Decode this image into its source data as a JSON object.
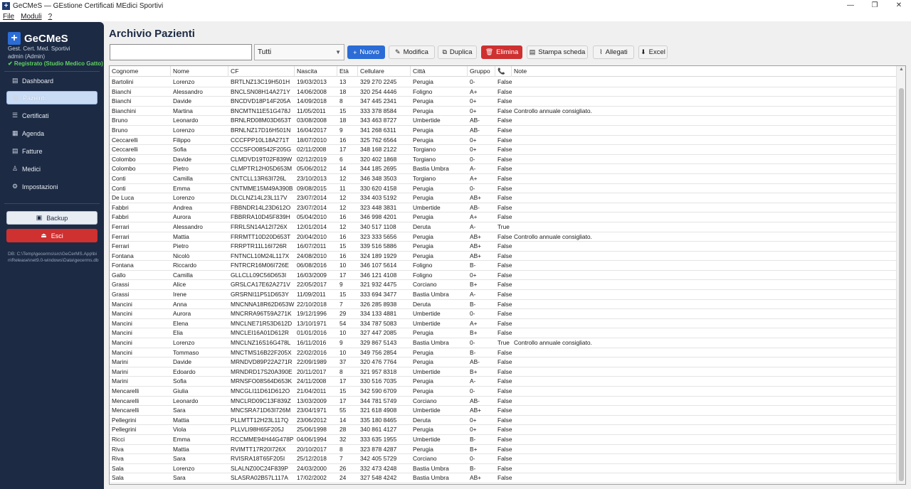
{
  "window": {
    "title": "GeCMeS — GEstione Certificati MEdici Sportivi"
  },
  "menu": [
    "File",
    "Moduli",
    "?"
  ],
  "sidebar": {
    "brand": "GeCMeS",
    "subtitle": "Gest. Cert. Med. Sportivi",
    "user": "admin (Admin)",
    "registered": "✔ Registrato (Studio Medico Gatto)",
    "items": [
      {
        "label": "Dashboard",
        "icon": "dashboard-icon",
        "glyph": "▤"
      },
      {
        "label": "Pazienti",
        "icon": "patients-icon",
        "glyph": "▦"
      },
      {
        "label": "Certificati",
        "icon": "certificate-icon",
        "glyph": "☰"
      },
      {
        "label": "Agenda",
        "icon": "calendar-icon",
        "glyph": "▦"
      },
      {
        "label": "Fatture",
        "icon": "invoice-icon",
        "glyph": "▤"
      },
      {
        "label": "Medici",
        "icon": "doctor-icon",
        "glyph": "♙"
      },
      {
        "label": "Impostazioni",
        "icon": "gear-icon",
        "glyph": "⚙"
      }
    ],
    "backup_label": "Backup",
    "exit_label": "Esci",
    "db_path": "DB: C:\\Temp\\gecerms\\src\\GeCerMS.App\\bin\\Release\\net9.0-windows\\Data\\gecerms.db"
  },
  "main": {
    "title": "Archivio Pazienti",
    "search": {
      "value": "",
      "placeholder": ""
    },
    "filter": "Tutti",
    "toolbar": {
      "new": "Nuovo",
      "edit": "Modifica",
      "duplicate": "Duplica",
      "delete": "Elimina",
      "print": "Stampa scheda",
      "attachments": "Allegati",
      "excel": "Excel"
    }
  },
  "table": {
    "columns": [
      "Cognome",
      "Nome",
      "CF",
      "Nascita",
      "Età",
      "Cellulare",
      "Città",
      "Gruppo",
      "📞",
      "Note"
    ],
    "rows": [
      [
        "Bartolini",
        "Lorenzo",
        "BRTLNZ13C19H501H",
        "19/03/2013",
        "13",
        "329 270 2245",
        "Perugia",
        "0-",
        "False",
        ""
      ],
      [
        "Bianchi",
        "Alessandro",
        "BNCLSN08H14A271Y",
        "14/06/2008",
        "18",
        "320 254 4446",
        "Foligno",
        "A+",
        "False",
        ""
      ],
      [
        "Bianchi",
        "Davide",
        "BNCDVD18P14F205A",
        "14/09/2018",
        "8",
        "347 445 2341",
        "Perugia",
        "0+",
        "False",
        ""
      ],
      [
        "Bianchini",
        "Martina",
        "BNCMTN11E51G478J",
        "11/05/2011",
        "15",
        "333 378 8584",
        "Perugia",
        "0+",
        "False",
        "Controllo annuale consigliato."
      ],
      [
        "Bruno",
        "Leonardo",
        "BRNLRD08M03D653T",
        "03/08/2008",
        "18",
        "343 463 8727",
        "Umbertide",
        "AB-",
        "False",
        ""
      ],
      [
        "Bruno",
        "Lorenzo",
        "BRNLNZ17D16H501N",
        "16/04/2017",
        "9",
        "341 268 6311",
        "Perugia",
        "AB-",
        "False",
        ""
      ],
      [
        "Ceccarelli",
        "Filippo",
        "CCCFPP10L18A271T",
        "18/07/2010",
        "16",
        "325 762 6564",
        "Perugia",
        "0+",
        "False",
        ""
      ],
      [
        "Ceccarelli",
        "Sofia",
        "CCCSFO08S42F205G",
        "02/11/2008",
        "17",
        "348 168 2122",
        "Torgiano",
        "0+",
        "False",
        ""
      ],
      [
        "Colombo",
        "Davide",
        "CLMDVD19T02F839W",
        "02/12/2019",
        "6",
        "320 402 1868",
        "Torgiano",
        "0-",
        "False",
        ""
      ],
      [
        "Colombo",
        "Pietro",
        "CLMPTR12H05D653M",
        "05/06/2012",
        "14",
        "344 185 2695",
        "Bastia Umbra",
        "A-",
        "False",
        ""
      ],
      [
        "Conti",
        "Camilla",
        "CNTCLL13R63I726L",
        "23/10/2013",
        "12",
        "346 348 3503",
        "Torgiano",
        "A+",
        "False",
        ""
      ],
      [
        "Conti",
        "Emma",
        "CNTMME15M49A390B",
        "09/08/2015",
        "11",
        "330 620 4158",
        "Perugia",
        "0-",
        "False",
        ""
      ],
      [
        "De Luca",
        "Lorenzo",
        "DLCLNZ14L23L117V",
        "23/07/2014",
        "12",
        "334 403 5192",
        "Perugia",
        "AB+",
        "False",
        ""
      ],
      [
        "Fabbri",
        "Andrea",
        "FBBNDR14L23D612O",
        "23/07/2014",
        "12",
        "323 448 3831",
        "Umbertide",
        "AB-",
        "False",
        ""
      ],
      [
        "Fabbri",
        "Aurora",
        "FBBRRA10D45F839H",
        "05/04/2010",
        "16",
        "346 998 4201",
        "Perugia",
        "A+",
        "False",
        ""
      ],
      [
        "Ferrari",
        "Alessandro",
        "FRRLSN14A12I726X",
        "12/01/2014",
        "12",
        "340 517 1108",
        "Deruta",
        "A-",
        "True",
        ""
      ],
      [
        "Ferrari",
        "Mattia",
        "FRRMTT10D20D653T",
        "20/04/2010",
        "16",
        "323 333 5656",
        "Perugia",
        "AB+",
        "False",
        "Controllo annuale consigliato."
      ],
      [
        "Ferrari",
        "Pietro",
        "FRRPTR11L16I726R",
        "16/07/2011",
        "15",
        "339 516 5886",
        "Perugia",
        "AB+",
        "False",
        ""
      ],
      [
        "Fontana",
        "Nicolò",
        "FNTNCL10M24L117X",
        "24/08/2010",
        "16",
        "324 189 1929",
        "Perugia",
        "AB+",
        "False",
        ""
      ],
      [
        "Fontana",
        "Riccardo",
        "FNTRCR16M06I726E",
        "06/08/2016",
        "10",
        "346 107 5614",
        "Foligno",
        "B-",
        "False",
        ""
      ],
      [
        "Gallo",
        "Camilla",
        "GLLCLL09C56D653I",
        "16/03/2009",
        "17",
        "346 121 4108",
        "Foligno",
        "0+",
        "False",
        ""
      ],
      [
        "Grassi",
        "Alice",
        "GRSLCA17E62A271V",
        "22/05/2017",
        "9",
        "321 932 4475",
        "Corciano",
        "B+",
        "False",
        ""
      ],
      [
        "Grassi",
        "Irene",
        "GRSRNI11P51D653Y",
        "11/09/2011",
        "15",
        "333 694 3477",
        "Bastia Umbra",
        "A-",
        "False",
        ""
      ],
      [
        "Mancini",
        "Anna",
        "MNCNNA18R62D653W",
        "22/10/2018",
        "7",
        "326 285 8938",
        "Deruta",
        "B-",
        "False",
        ""
      ],
      [
        "Mancini",
        "Aurora",
        "MNCRRA96T59A271K",
        "19/12/1996",
        "29",
        "334 133 4881",
        "Umbertide",
        "0-",
        "False",
        ""
      ],
      [
        "Mancini",
        "Elena",
        "MNCLNE71R53D612D",
        "13/10/1971",
        "54",
        "334 787 5083",
        "Umbertide",
        "A+",
        "False",
        ""
      ],
      [
        "Mancini",
        "Elia",
        "MNCLEI16A01D612R",
        "01/01/2016",
        "10",
        "327 447 2085",
        "Perugia",
        "B+",
        "False",
        ""
      ],
      [
        "Mancini",
        "Lorenzo",
        "MNCLNZ16S16G478L",
        "16/11/2016",
        "9",
        "329 867 5143",
        "Bastia Umbra",
        "0-",
        "True",
        "Controllo annuale consigliato."
      ],
      [
        "Mancini",
        "Tommaso",
        "MNCTMS16B22F205X",
        "22/02/2016",
        "10",
        "349 756 2854",
        "Perugia",
        "B-",
        "False",
        ""
      ],
      [
        "Marini",
        "Davide",
        "MRNDVD89P22A271R",
        "22/09/1989",
        "37",
        "320 476 7764",
        "Perugia",
        "AB-",
        "False",
        ""
      ],
      [
        "Marini",
        "Edoardo",
        "MRNDRD17S20A390E",
        "20/11/2017",
        "8",
        "321 957 8318",
        "Umbertide",
        "B+",
        "False",
        ""
      ],
      [
        "Marini",
        "Sofia",
        "MRNSFO08S64D653K",
        "24/11/2008",
        "17",
        "330 516 7035",
        "Perugia",
        "A-",
        "False",
        ""
      ],
      [
        "Mencarelli",
        "Giulia",
        "MNCGLI11D61D612O",
        "21/04/2011",
        "15",
        "342 590 6709",
        "Perugia",
        "0-",
        "False",
        ""
      ],
      [
        "Mencarelli",
        "Leonardo",
        "MNCLRD09C13F839Z",
        "13/03/2009",
        "17",
        "344 781 5749",
        "Corciano",
        "AB-",
        "False",
        ""
      ],
      [
        "Mencarelli",
        "Sara",
        "MNCSRA71D63I726M",
        "23/04/1971",
        "55",
        "321 618 4908",
        "Umbertide",
        "AB+",
        "False",
        ""
      ],
      [
        "Pellegrini",
        "Mattia",
        "PLLMTT12H23L117Q",
        "23/06/2012",
        "14",
        "335 180 8465",
        "Deruta",
        "0+",
        "False",
        ""
      ],
      [
        "Pellegrini",
        "Viola",
        "PLLVLI98H65F205J",
        "25/06/1998",
        "28",
        "340 861 4127",
        "Perugia",
        "0+",
        "False",
        ""
      ],
      [
        "Ricci",
        "Emma",
        "RCCMME94H44G478P",
        "04/06/1994",
        "32",
        "333 635 1955",
        "Umbertide",
        "B-",
        "False",
        ""
      ],
      [
        "Riva",
        "Mattia",
        "RVIMTT17R20I726X",
        "20/10/2017",
        "8",
        "323 878 4287",
        "Perugia",
        "B+",
        "False",
        ""
      ],
      [
        "Riva",
        "Sara",
        "RVISRA18T65F205I",
        "25/12/2018",
        "7",
        "342 405 5729",
        "Corciano",
        "0-",
        "False",
        ""
      ],
      [
        "Sala",
        "Lorenzo",
        "SLALNZ00C24F839P",
        "24/03/2000",
        "26",
        "332 473 4248",
        "Bastia Umbra",
        "B-",
        "False",
        ""
      ],
      [
        "Sala",
        "Sara",
        "SLASRA02B57L117A",
        "17/02/2002",
        "24",
        "327 548 4242",
        "Bastia Umbra",
        "AB+",
        "False",
        ""
      ]
    ]
  }
}
